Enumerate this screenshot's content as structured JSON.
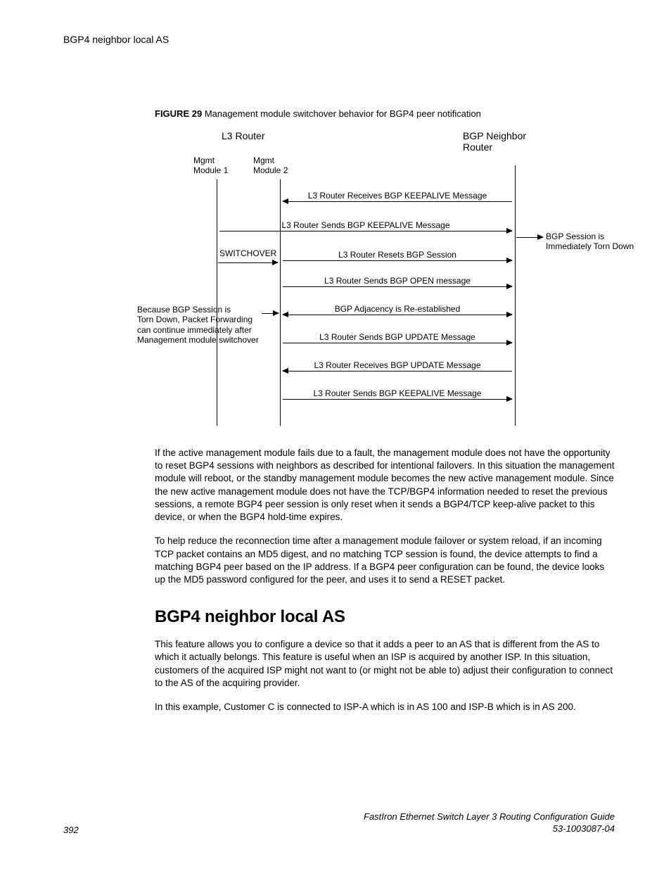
{
  "header": {
    "running_head": "BGP4 neighbor local AS"
  },
  "figure": {
    "label": "FIGURE 29",
    "caption": "Management module switchover behavior for BGP4 peer notification",
    "l3_router": "L3 Router",
    "bgp_neighbor_router": "BGP Neighbor\nRouter",
    "mgmt1": "Mgmt\nModule 1",
    "mgmt2": "Mgmt\nModule 2",
    "switchover": "SWITCHOVER",
    "left_note": "Because BGP Session is\nTorn Down, Packet Forwarding\ncan continue immediately after\nManagement module switchover",
    "right_note": "BGP Session is\nImmediately Torn Down",
    "messages": [
      "L3 Router Receives BGP KEEPALIVE Message",
      "L3 Router Sends BGP KEEPALIVE Message",
      "L3 Router Resets BGP Session",
      "L3 Router Sends BGP OPEN message",
      "BGP Adjacency is Re-established",
      "L3 Router Sends BGP UPDATE Message",
      "L3 Router Receives BGP UPDATE Message",
      "L3 Router Sends BGP KEEPALIVE Message"
    ]
  },
  "paragraphs": {
    "p1": "If the active management module fails due to a fault, the management module does not have the opportunity to reset BGP4 sessions with neighbors as described for intentional failovers. In this situation the management module will reboot, or the standby management module becomes the new active management module. Since the new active management module does not have the TCP/BGP4 information needed to reset the previous sessions, a remote BGP4 peer session is only reset when it sends a BGP4/TCP keep-alive packet to this device, or when the BGP4 hold-time expires.",
    "p2": "To help reduce the reconnection time after a management module failover or system reload, if an incoming TCP packet contains an MD5 digest, and no matching TCP session is found, the device attempts to find a matching BGP4 peer based on the IP address. If a BGP4 peer configuration can be found, the device looks up the MD5 password configured for the peer, and uses it to send a RESET packet."
  },
  "section": {
    "heading": "BGP4 neighbor local AS",
    "p1": "This feature allows you to configure a device so that it adds a peer to an AS that is different from the AS to which it actually belongs. This feature is useful when an ISP is acquired by another ISP. In this situation, customers of the acquired ISP might not want to (or might not be able to) adjust their configuration to connect to the AS of the acquiring provider.",
    "p2": "In this example, Customer C is connected to ISP-A which is in AS 100 and ISP-B which is in AS 200."
  },
  "footer": {
    "page_number": "392",
    "doc_title": "FastIron Ethernet Switch Layer 3 Routing Configuration Guide",
    "doc_number": "53-1003087-04"
  }
}
